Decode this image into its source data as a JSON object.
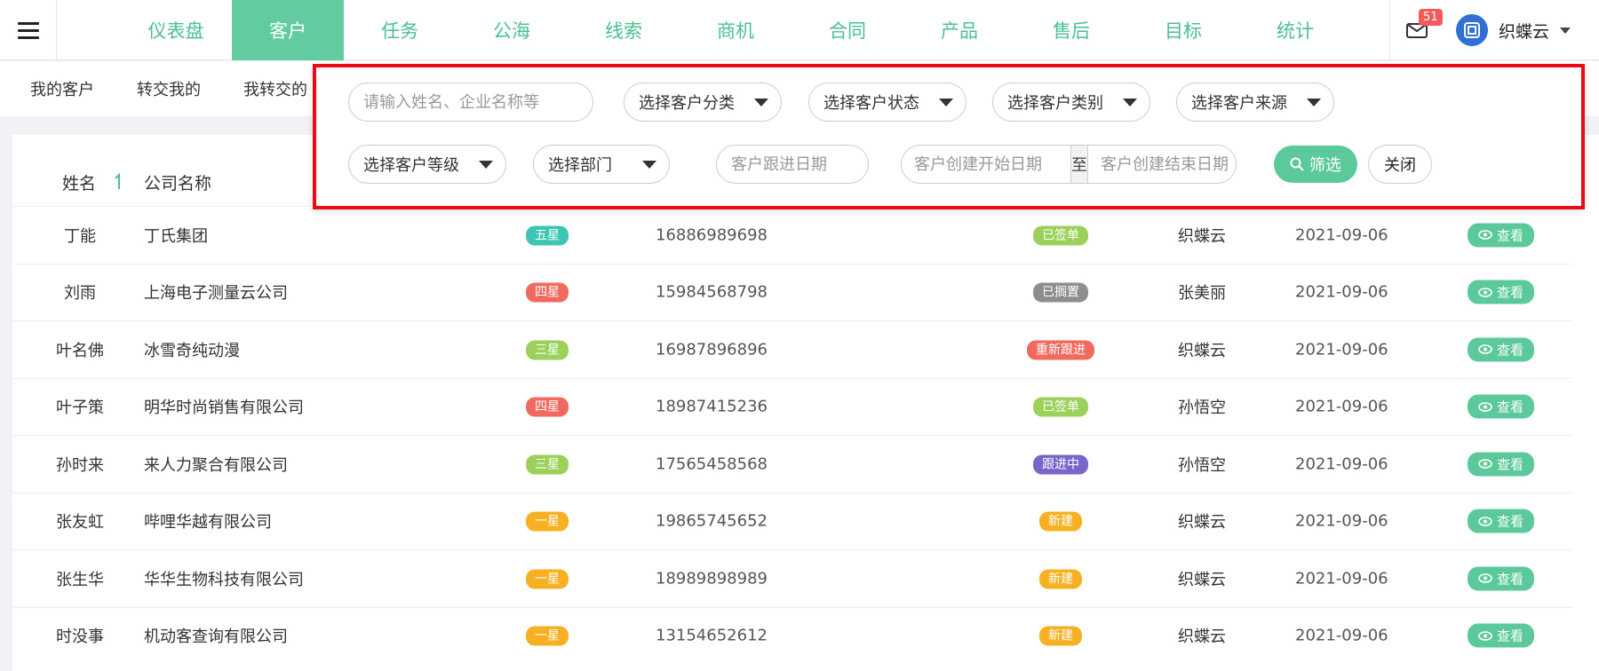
{
  "nav": {
    "items": [
      "仪表盘",
      "客户",
      "任务",
      "公海",
      "线索",
      "商机",
      "合同",
      "产品",
      "售后",
      "目标",
      "统计"
    ],
    "active_index": 1
  },
  "header": {
    "mail_count": "51",
    "user_name": "织蝶云"
  },
  "subtabs": [
    "我的客户",
    "转交我的",
    "我转交的"
  ],
  "filter": {
    "search_placeholder": "请输入姓名、企业名称等",
    "select_category": "选择客户分类",
    "select_status": "选择客户状态",
    "select_type": "选择客户类别",
    "select_source": "选择客户来源",
    "select_level": "选择客户等级",
    "select_department": "选择部门",
    "follow_date_placeholder": "客户跟进日期",
    "create_start_placeholder": "客户创建开始日期",
    "range_separator": "至",
    "create_end_placeholder": "客户创建结束日期",
    "filter_button": "筛选",
    "close_button": "关闭"
  },
  "table": {
    "columns": {
      "name": "姓名",
      "company": "公司名称"
    },
    "rows": [
      {
        "name": "丁能",
        "company": "丁氏集团",
        "star": "五星",
        "star_color": "#3fc5b4",
        "phone": "16886989698",
        "status": "已签单",
        "status_color": "#9bd15a",
        "owner": "织蝶云",
        "date": "2021-09-06",
        "view": "查看"
      },
      {
        "name": "刘雨",
        "company": "上海电子测量云公司",
        "star": "四星",
        "star_color": "#f26a5f",
        "phone": "15984568798",
        "status": "已搁置",
        "status_color": "#8d8d8d",
        "owner": "张美丽",
        "date": "2021-09-06",
        "view": "查看"
      },
      {
        "name": "叶名佛",
        "company": "冰雪奇纯动漫",
        "star": "三星",
        "star_color": "#9bd15a",
        "phone": "16987896896",
        "status": "重新跟进",
        "status_color": "#f26a5f",
        "owner": "织蝶云",
        "date": "2021-09-06",
        "view": "查看"
      },
      {
        "name": "叶子策",
        "company": "明华时尚销售有限公司",
        "star": "四星",
        "star_color": "#f26a5f",
        "phone": "18987415236",
        "status": "已签单",
        "status_color": "#9bd15a",
        "owner": "孙悟空",
        "date": "2021-09-06",
        "view": "查看"
      },
      {
        "name": "孙时来",
        "company": "来人力聚合有限公司",
        "star": "三星",
        "star_color": "#9bd15a",
        "phone": "17565458568",
        "status": "跟进中",
        "status_color": "#7a66c9",
        "owner": "孙悟空",
        "date": "2021-09-06",
        "view": "查看"
      },
      {
        "name": "张友虹",
        "company": "哔哩华越有限公司",
        "star": "一星",
        "star_color": "#f7b022",
        "phone": "19865745652",
        "status": "新建",
        "status_color": "#f7b022",
        "owner": "织蝶云",
        "date": "2021-09-06",
        "view": "查看"
      },
      {
        "name": "张生华",
        "company": "华华生物科技有限公司",
        "star": "一星",
        "star_color": "#f7b022",
        "phone": "18989898989",
        "status": "新建",
        "status_color": "#f7b022",
        "owner": "织蝶云",
        "date": "2021-09-06",
        "view": "查看"
      },
      {
        "name": "时没事",
        "company": "机动客查询有限公司",
        "star": "一星",
        "star_color": "#f7b022",
        "phone": "13154652612",
        "status": "新建",
        "status_color": "#f7b022",
        "owner": "织蝶云",
        "date": "2021-09-06",
        "view": "查看"
      }
    ]
  }
}
